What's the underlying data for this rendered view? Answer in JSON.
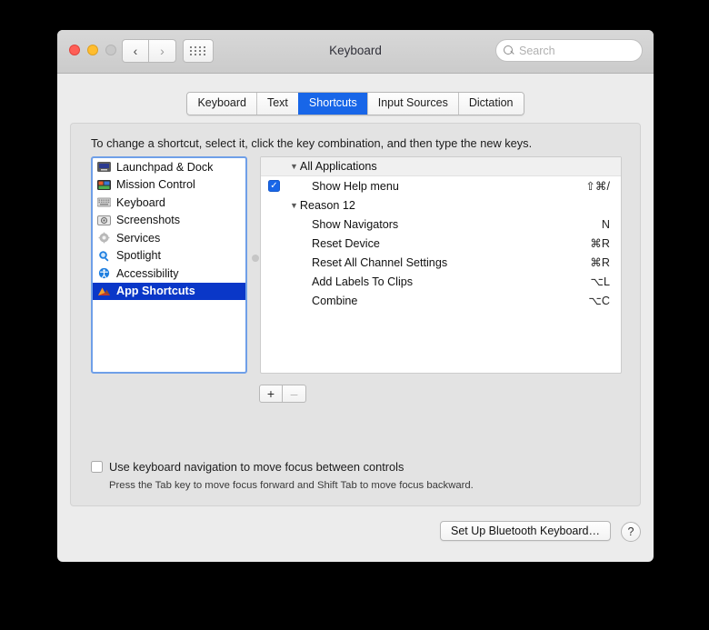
{
  "window": {
    "title": "Keyboard",
    "traffic": {
      "close": "close-button",
      "minimize": "minimize-button",
      "zoom": "zoom-button"
    },
    "nav": {
      "back": "‹",
      "forward": "›"
    },
    "search": {
      "placeholder": "Search",
      "value": ""
    }
  },
  "tabs": [
    {
      "label": "Keyboard",
      "active": false
    },
    {
      "label": "Text",
      "active": false
    },
    {
      "label": "Shortcuts",
      "active": true
    },
    {
      "label": "Input Sources",
      "active": false
    },
    {
      "label": "Dictation",
      "active": false
    }
  ],
  "hint": "To change a shortcut, select it, click the key combination, and then type the new keys.",
  "categories": [
    {
      "label": "Launchpad & Dock",
      "icon": "launchpad-dock-icon",
      "selected": false
    },
    {
      "label": "Mission Control",
      "icon": "mission-control-icon",
      "selected": false
    },
    {
      "label": "Keyboard",
      "icon": "keyboard-icon",
      "selected": false
    },
    {
      "label": "Screenshots",
      "icon": "screenshots-icon",
      "selected": false
    },
    {
      "label": "Services",
      "icon": "services-gear-icon",
      "selected": false
    },
    {
      "label": "Spotlight",
      "icon": "spotlight-icon",
      "selected": false
    },
    {
      "label": "Accessibility",
      "icon": "accessibility-icon",
      "selected": false
    },
    {
      "label": "App Shortcuts",
      "icon": "app-shortcuts-icon",
      "selected": true
    }
  ],
  "shortcut_groups": [
    {
      "name": "All Applications",
      "header_shaded": true,
      "items": [
        {
          "label": "Show Help menu",
          "key": "⇧⌘/",
          "checked": true
        }
      ]
    },
    {
      "name": "Reason 12",
      "header_shaded": false,
      "items": [
        {
          "label": "Show Navigators",
          "key": "N",
          "checked": false
        },
        {
          "label": "Reset Device",
          "key": "⌘R",
          "checked": false
        },
        {
          "label": "Reset All Channel Settings",
          "key": "⌘R",
          "checked": false
        },
        {
          "label": "Add Labels To Clips",
          "key": "⌥L",
          "checked": false
        },
        {
          "label": "Combine",
          "key": "⌥C",
          "checked": false
        }
      ]
    }
  ],
  "list_buttons": {
    "add": "+",
    "remove": "–"
  },
  "keyboard_nav": {
    "label": "Use keyboard navigation to move focus between controls",
    "checked": false,
    "note": "Press the Tab key to move focus forward and Shift Tab to move focus backward."
  },
  "footer": {
    "bluetooth_button": "Set Up Bluetooth Keyboard…",
    "help_button": "?"
  },
  "colors": {
    "accent_blue": "#1866e8",
    "selection_blue": "#0a37c8",
    "focus_ring": "#6f9fe8"
  }
}
